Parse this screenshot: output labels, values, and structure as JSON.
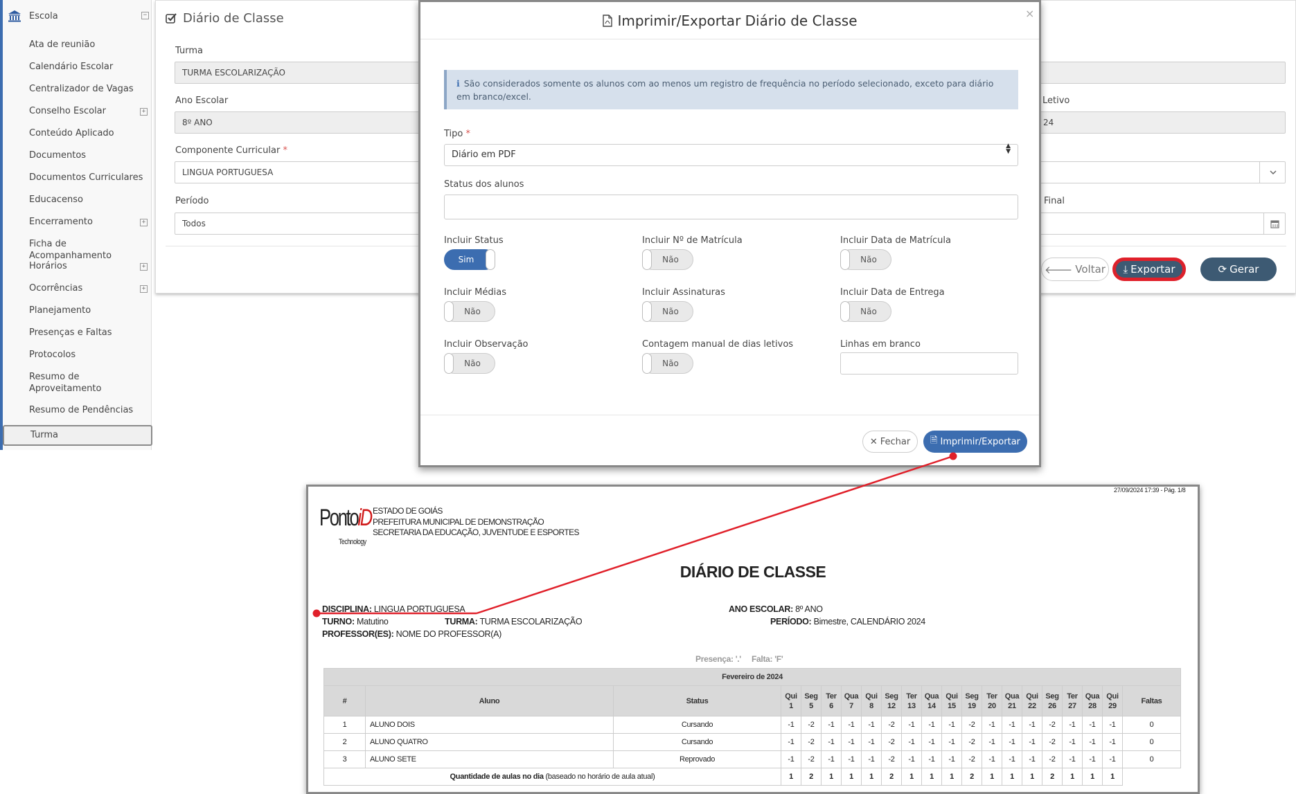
{
  "sidebar": {
    "header": "Escola",
    "items": [
      {
        "label": "Ata de reunião",
        "expand": false
      },
      {
        "label": "Calendário Escolar",
        "expand": false
      },
      {
        "label": "Centralizador de Vagas",
        "expand": false
      },
      {
        "label": "Conselho Escolar",
        "expand": true
      },
      {
        "label": "Conteúdo Aplicado",
        "expand": false
      },
      {
        "label": "Documentos",
        "expand": false
      },
      {
        "label": "Documentos Curriculares",
        "expand": false
      },
      {
        "label": "Educacenso",
        "expand": false
      },
      {
        "label": "Encerramento",
        "expand": true
      },
      {
        "label": "Ficha de Acompanhamento",
        "expand": false
      },
      {
        "label": "Horários",
        "expand": true
      },
      {
        "label": "Ocorrências",
        "expand": true
      },
      {
        "label": "Planejamento",
        "expand": false
      },
      {
        "label": "Presenças e Faltas",
        "expand": false
      },
      {
        "label": "Protocolos",
        "expand": false
      },
      {
        "label": "Resumo de Aproveitamento",
        "expand": false
      },
      {
        "label": "Resumo de Pendências",
        "expand": false
      },
      {
        "label": "Turma",
        "expand": false,
        "active": true
      }
    ]
  },
  "form": {
    "title": "Diário de Classe",
    "turma_label": "Turma",
    "turma_value": "TURMA ESCOLARIZAÇÃO",
    "ano_label": "Ano Escolar",
    "ano_value": "8º ANO",
    "componente_label": "Componente Curricular",
    "componente_value": "LINGUA PORTUGUESA",
    "periodo_label": "Período",
    "periodo_value": "Todos",
    "letivo_label_partial": "Letivo",
    "letivo_value_partial": "24",
    "final_label_partial": "Final",
    "voltar": "Voltar",
    "exportar": "Exportar",
    "gerar": "Gerar"
  },
  "modal": {
    "title": "Imprimir/Exportar Diário de Classe",
    "close_glyph": "×",
    "info": "São considerados somente os alunos com ao menos um registro de frequência no período selecionado, exceto para diário em branco/excel.",
    "tipo_label": "Tipo",
    "tipo_value": "Diário em PDF",
    "status_label": "Status dos alunos",
    "status_value": "",
    "toggles": [
      {
        "label": "Incluir Status",
        "value": "Sim",
        "on": true
      },
      {
        "label": "Incluir Nº de Matrícula",
        "value": "Não",
        "on": false
      },
      {
        "label": "Incluir Data de Matrícula",
        "value": "Não",
        "on": false
      },
      {
        "label": "Incluir Médias",
        "value": "Não",
        "on": false
      },
      {
        "label": "Incluir Assinaturas",
        "value": "Não",
        "on": false
      },
      {
        "label": "Incluir Data de Entrega",
        "value": "Não",
        "on": false
      },
      {
        "label": "Incluir Observação",
        "value": "Não",
        "on": false
      },
      {
        "label": "Contagem manual de dias letivos",
        "value": "Não",
        "on": false
      }
    ],
    "linhas_label": "Linhas em branco",
    "linhas_value": "",
    "fechar": "Fechar",
    "imprimir": "Imprimir/Exportar"
  },
  "report": {
    "timestamp": "27/09/2024 17:39 - Pág. 1/8",
    "logo_main": "Ponto",
    "logo_id": "iD",
    "logo_sub": "Technology",
    "header_lines": [
      "ESTADO DE GOIÁS",
      "PREFEITURA MUNICIPAL DE DEMONSTRAÇÃO",
      "SECRETARIA DA EDUCAÇÃO, JUVENTUDE E ESPORTES"
    ],
    "title": "DIÁRIO DE CLASSE",
    "disciplina_label": "DISCIPLINA:",
    "disciplina_value": "LINGUA PORTUGUESA",
    "turno_label": "TURNO:",
    "turno_value": "Matutino",
    "turma_label": "TURMA:",
    "turma_value": "TURMA ESCOLARIZAÇÃO",
    "professor_label": "PROFESSOR(ES):",
    "professor_value": "NOME DO PROFESSOR(A)",
    "ano_label": "ANO ESCOLAR:",
    "ano_value": "8º ANO",
    "periodo_label": "PERÍODO:",
    "periodo_value": "Bimestre, CALENDÁRIO 2024",
    "legend": "Presença: '.'     Falta: 'F'",
    "month": "Fevereiro de 2024",
    "col_num": "#",
    "col_aluno": "Aluno",
    "col_status": "Status",
    "col_faltas": "Faltas",
    "days": [
      {
        "wd": "Qui",
        "d": "1"
      },
      {
        "wd": "Seg",
        "d": "5"
      },
      {
        "wd": "Ter",
        "d": "6"
      },
      {
        "wd": "Qua",
        "d": "7"
      },
      {
        "wd": "Qui",
        "d": "8"
      },
      {
        "wd": "Seg",
        "d": "12"
      },
      {
        "wd": "Ter",
        "d": "13"
      },
      {
        "wd": "Qua",
        "d": "14"
      },
      {
        "wd": "Qui",
        "d": "15"
      },
      {
        "wd": "Seg",
        "d": "19"
      },
      {
        "wd": "Ter",
        "d": "20"
      },
      {
        "wd": "Qua",
        "d": "21"
      },
      {
        "wd": "Qui",
        "d": "22"
      },
      {
        "wd": "Seg",
        "d": "26"
      },
      {
        "wd": "Ter",
        "d": "27"
      },
      {
        "wd": "Qua",
        "d": "28"
      },
      {
        "wd": "Qui",
        "d": "29"
      }
    ],
    "rows": [
      {
        "n": "1",
        "aluno": "ALUNO DOIS",
        "status": "Cursando",
        "vals": [
          "-1",
          "-2",
          "-1",
          "-1",
          "-1",
          "-2",
          "-1",
          "-1",
          "-1",
          "-2",
          "-1",
          "-1",
          "-1",
          "-2",
          "-1",
          "-1",
          "-1"
        ],
        "faltas": "0"
      },
      {
        "n": "2",
        "aluno": "ALUNO QUATRO",
        "status": "Cursando",
        "vals": [
          "-1",
          "-2",
          "-1",
          "-1",
          "-1",
          "-2",
          "-1",
          "-1",
          "-1",
          "-2",
          "-1",
          "-1",
          "-1",
          "-2",
          "-1",
          "-1",
          "-1"
        ],
        "faltas": "0"
      },
      {
        "n": "3",
        "aluno": "ALUNO SETE",
        "status": "Reprovado",
        "vals": [
          "-1",
          "-2",
          "-1",
          "-1",
          "-1",
          "-2",
          "-1",
          "-1",
          "-1",
          "-2",
          "-1",
          "-1",
          "-1",
          "-2",
          "-1",
          "-1",
          "-1"
        ],
        "faltas": "0"
      }
    ],
    "qtd_label_bold": "Quantidade de aulas no dia",
    "qtd_label_rest": " (baseado no horário de aula atual)",
    "qtd": [
      "1",
      "2",
      "1",
      "1",
      "1",
      "2",
      "1",
      "1",
      "1",
      "2",
      "1",
      "1",
      "1",
      "2",
      "1",
      "1",
      "1"
    ]
  },
  "colors": {
    "accent": "#3c6db0",
    "dark_button": "#3d5a73",
    "highlight": "#e0202a",
    "info_bg": "#d6e0ec"
  }
}
